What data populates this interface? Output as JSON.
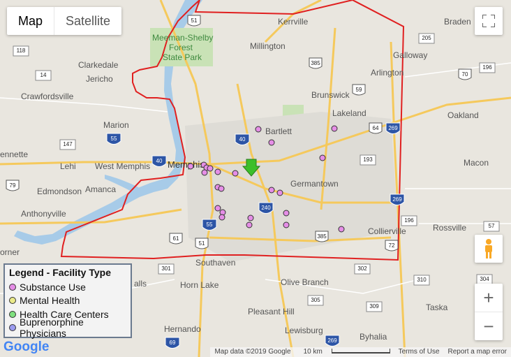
{
  "map_type": {
    "map": "Map",
    "satellite": "Satellite"
  },
  "places": {
    "kerrville": "Kerrville",
    "braden": "Braden",
    "meeman": "Meeman-Shelby",
    "forest": "Forest",
    "state_park": "State Park",
    "millington": "Millington",
    "galloway": "Galloway",
    "clarkedale": "Clarkedale",
    "jericho": "Jericho",
    "arlington": "Arlington",
    "brunswick": "Brunswick",
    "crawfordsville": "Crawfordsville",
    "lakeland": "Lakeland",
    "oakland": "Oakland",
    "marion": "Marion",
    "bartlett": "Bartlett",
    "ennette": "ennette",
    "lehi": "Lehi",
    "west_memphis": "West Memphis",
    "memphis": "Memphis",
    "macon": "Macon",
    "edmondson": "Edmondson",
    "amanca": "Amanca",
    "germantown": "Germantown",
    "anthonyville": "Anthonyville",
    "collierville": "Collierville",
    "rossville": "Rossville",
    "orner": "orner",
    "southaven": "Southaven",
    "horn_lake": "Horn Lake",
    "olive_branch": "Olive Branch",
    "alls": "alls",
    "pleasant_hill": "Pleasant Hill",
    "taska": "Taska",
    "hernando": "Hernando",
    "lewisburg": "Lewisburg",
    "byhalia": "Byhalia"
  },
  "routes": {
    "r51a": "51",
    "r118": "118",
    "r14": "14",
    "r385a": "385",
    "r205": "205",
    "r196a": "196",
    "r70": "70",
    "r55a": "55",
    "r59": "59",
    "r40a": "40",
    "r64": "64",
    "r269a": "269",
    "r40b": "40",
    "r147": "147",
    "r193": "193",
    "r79": "79",
    "r240": "240",
    "r269b": "269",
    "r196b": "196",
    "r57": "57",
    "r55b": "55",
    "r385b": "385",
    "r61": "61",
    "r51b": "51",
    "r72": "72",
    "r301": "301",
    "r302": "302",
    "r305": "305",
    "r309": "309",
    "r310": "310",
    "r304": "304",
    "r69": "69",
    "r269c": "269"
  },
  "legend": {
    "title": "Legend - Facility Type",
    "items": [
      {
        "label": "Substance Use",
        "color": "#e58ee6"
      },
      {
        "label": "Mental Health",
        "color": "#eaea8a"
      },
      {
        "label": "Health Care Centers",
        "color": "#7fe07f"
      },
      {
        "label": "Buprenorphine Physicians",
        "color": "#9b9bef"
      }
    ]
  },
  "footer": {
    "map_data": "Map data ©2019 Google",
    "scale": "10 km",
    "terms": "Terms of Use",
    "report": "Report a map error"
  },
  "google_logo": "Google",
  "colors": {
    "boundary": "#e02020",
    "facility": "#e58ee6",
    "marker": "#3cbf2a"
  }
}
